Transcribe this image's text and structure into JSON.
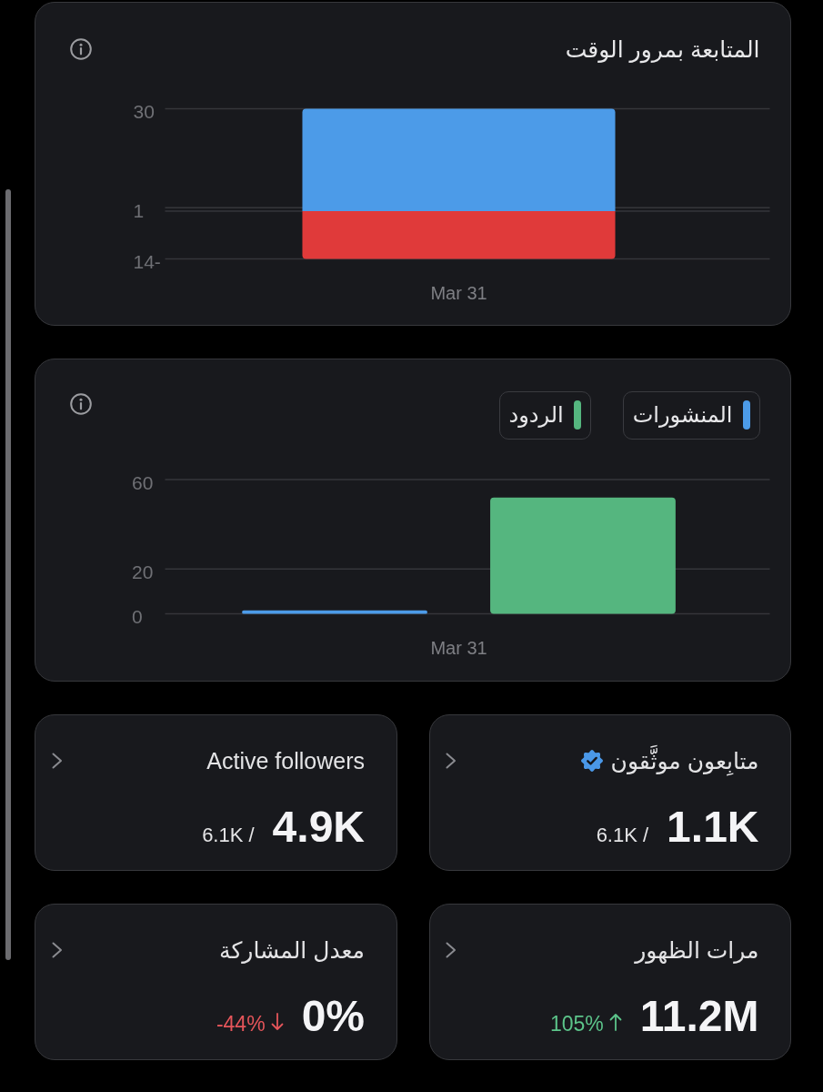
{
  "follower_chart": {
    "title": "المتابعة بمرور الوقت",
    "chart_data": {
      "type": "bar",
      "categories": [
        "Mar 31"
      ],
      "series": [
        {
          "color": "#4c9be8",
          "values": [
            30
          ]
        },
        {
          "color": "#e03a3a",
          "values": [
            -14
          ]
        }
      ],
      "stacked": true,
      "ylim": [
        -14,
        30
      ],
      "yticks": [
        30,
        1,
        {
          "value": -14,
          "label": "14-"
        }
      ]
    }
  },
  "activity_chart": {
    "chart_data": {
      "type": "bar",
      "categories": [
        "Mar 31"
      ],
      "series": [
        {
          "name": "المنشورات",
          "color": "#4c9be8",
          "values": [
            1.5
          ]
        },
        {
          "name": "الردود",
          "color": "#55b67f",
          "values": [
            52
          ]
        }
      ],
      "stacked": false,
      "ylim": [
        0,
        60
      ],
      "yticks": [
        0,
        20,
        60
      ]
    }
  },
  "stats": [
    {
      "kind": "ratio",
      "title": "متابِعون موثَّقون",
      "verified": true,
      "value": "1.1K",
      "total": "6.1K /"
    },
    {
      "kind": "ratio",
      "title": "Active followers",
      "verified": false,
      "value": "4.9K",
      "total": "6.1K /"
    },
    {
      "kind": "change",
      "title": "مرات الظهور",
      "verified": false,
      "value": "11.2M",
      "change": "105%",
      "increase": true
    },
    {
      "kind": "change",
      "title": "معدل المشاركة",
      "verified": false,
      "value": "0%",
      "change": "-44%",
      "increase": false
    }
  ]
}
